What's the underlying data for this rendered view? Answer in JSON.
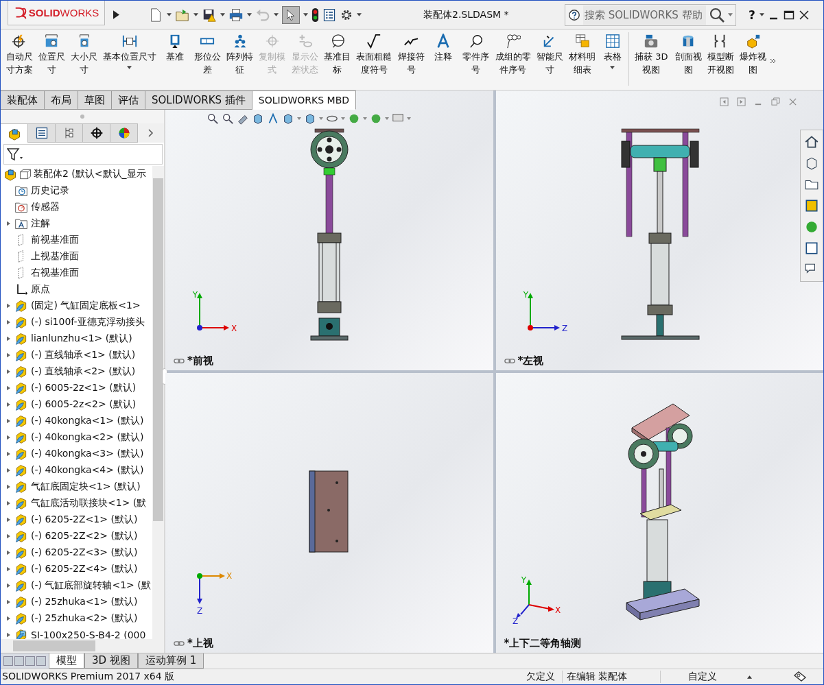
{
  "app": {
    "logo": "**SOLID**WORKS",
    "title": "装配体2.SLDASM *",
    "search": {
      "placeholder": "搜索 SOLIDWORKS 帮助"
    },
    "help": "?"
  },
  "ribbon": {
    "buttons": [
      {
        "label": "自动尺寸方案",
        "disabled": false,
        "dropdown": false
      },
      {
        "label": "位置尺寸",
        "disabled": false,
        "dropdown": false
      },
      {
        "label": "大小尺寸",
        "disabled": false,
        "dropdown": false
      },
      {
        "label": "基本位置尺寸",
        "disabled": false,
        "dropdown": true
      },
      {
        "label": "基准",
        "disabled": false,
        "dropdown": false
      },
      {
        "label": "形位公差",
        "disabled": false,
        "dropdown": false
      },
      {
        "label": "阵列特征",
        "disabled": false,
        "dropdown": false
      },
      {
        "label": "复制模式",
        "disabled": true,
        "dropdown": false
      },
      {
        "label": "显示公差状态",
        "disabled": true,
        "dropdown": false
      },
      {
        "label": "基准目标",
        "disabled": false,
        "dropdown": false
      },
      {
        "label": "表面粗糙度符号",
        "disabled": false,
        "dropdown": false
      },
      {
        "label": "焊接符号",
        "disabled": false,
        "dropdown": false
      },
      {
        "label": "注释",
        "disabled": false,
        "dropdown": false
      },
      {
        "label": "零件序号",
        "disabled": false,
        "dropdown": false
      },
      {
        "label": "成组的零件序号",
        "disabled": false,
        "dropdown": false
      },
      {
        "label": "智能尺寸",
        "disabled": false,
        "dropdown": false
      },
      {
        "label": "材料明细表",
        "disabled": false,
        "dropdown": false
      },
      {
        "label": "表格",
        "disabled": false,
        "dropdown": true
      },
      {
        "label": "捕获 3D 视图",
        "disabled": false,
        "dropdown": false
      },
      {
        "label": "剖面视图",
        "disabled": false,
        "dropdown": false
      },
      {
        "label": "模型断开视图",
        "disabled": false,
        "dropdown": false
      },
      {
        "label": "爆炸视图",
        "disabled": false,
        "dropdown": false
      }
    ]
  },
  "command_tabs": [
    {
      "label": "装配体",
      "selected": false
    },
    {
      "label": "布局",
      "selected": false
    },
    {
      "label": "草图",
      "selected": false
    },
    {
      "label": "评估",
      "selected": false
    },
    {
      "label": "SOLIDWORKS 插件",
      "selected": false
    },
    {
      "label": "SOLIDWORKS MBD",
      "selected": true
    }
  ],
  "panel_tabs": [
    {
      "selected": true
    },
    {
      "selected": false
    },
    {
      "selected": false
    },
    {
      "selected": false
    },
    {
      "selected": false
    }
  ],
  "feature_tree": {
    "items": [
      {
        "label": "装配体2  (默认<默认_显示",
        "kind": "assembly",
        "collapsible": false,
        "children": [
          {
            "label": "历史记录",
            "kind": "history",
            "collapsible": false
          },
          {
            "label": "传感器",
            "kind": "sensor",
            "collapsible": false
          },
          {
            "label": "注解",
            "kind": "annotation",
            "collapsible": true
          },
          {
            "label": "前视基准面",
            "kind": "plane",
            "collapsible": false
          },
          {
            "label": "上视基准面",
            "kind": "plane",
            "collapsible": false
          },
          {
            "label": "右视基准面",
            "kind": "plane",
            "collapsible": false
          },
          {
            "label": "原点",
            "kind": "origin",
            "collapsible": false
          },
          {
            "label": "(固定) 气缸固定底板<1>",
            "kind": "part",
            "collapsible": true
          },
          {
            "label": "(-) si100f-亚德克浮动接头",
            "kind": "part",
            "collapsible": true
          },
          {
            "label": "lianlunzhu<1> (默认)",
            "kind": "part",
            "collapsible": true
          },
          {
            "label": "(-) 直线轴承<1> (默认)",
            "kind": "part",
            "collapsible": true
          },
          {
            "label": "(-) 直线轴承<2> (默认)",
            "kind": "part",
            "collapsible": true
          },
          {
            "label": "(-) 6005-2z<1> (默认)",
            "kind": "part",
            "collapsible": true
          },
          {
            "label": "(-) 6005-2z<2> (默认)",
            "kind": "part",
            "collapsible": true
          },
          {
            "label": "(-) 40kongka<1> (默认)",
            "kind": "part",
            "collapsible": true
          },
          {
            "label": "(-) 40kongka<2> (默认)",
            "kind": "part",
            "collapsible": true
          },
          {
            "label": "(-) 40kongka<3> (默认)",
            "kind": "part",
            "collapsible": true
          },
          {
            "label": "(-) 40kongka<4> (默认)",
            "kind": "part",
            "collapsible": true
          },
          {
            "label": "气缸底固定块<1> (默认)",
            "kind": "part",
            "collapsible": true
          },
          {
            "label": "气缸底活动联接块<1> (默",
            "kind": "part",
            "collapsible": true
          },
          {
            "label": "(-) 6205-2Z<1> (默认)",
            "kind": "part",
            "collapsible": true
          },
          {
            "label": "(-) 6205-2Z<2> (默认)",
            "kind": "part",
            "collapsible": true
          },
          {
            "label": "(-) 6205-2Z<3> (默认)",
            "kind": "part",
            "collapsible": true
          },
          {
            "label": "(-) 6205-2Z<4> (默认)",
            "kind": "part",
            "collapsible": true
          },
          {
            "label": "(-) 气缸底部旋转轴<1> (默",
            "kind": "part",
            "collapsible": true
          },
          {
            "label": "(-) 25zhuka<1> (默认)",
            "kind": "part",
            "collapsible": true
          },
          {
            "label": "(-) 25zhuka<2> (默认)",
            "kind": "part",
            "collapsible": true
          },
          {
            "label": "SI-100x250-S-B4-2 (000",
            "kind": "subassembly",
            "collapsible": true
          }
        ]
      }
    ]
  },
  "viewports": [
    {
      "kind": "front",
      "label": "*前视",
      "linked": true,
      "axes": [
        "Y",
        "X"
      ]
    },
    {
      "kind": "left",
      "label": "*左视",
      "linked": true,
      "axes": [
        "Y",
        "Z"
      ]
    },
    {
      "kind": "top",
      "label": "*上视",
      "linked": true,
      "axes": [
        "X",
        "Z"
      ]
    },
    {
      "kind": "iso",
      "label": "*上下二等角轴测",
      "linked": false,
      "axes": [
        "Y",
        "X",
        "Z"
      ]
    }
  ],
  "bottom_tabs": [
    {
      "label": "模型",
      "selected": true
    },
    {
      "label": "3D 视图",
      "selected": false
    },
    {
      "label": "运动算例 1",
      "selected": false
    }
  ],
  "status_bar": {
    "product": "SOLIDWORKS Premium 2017 x64 版",
    "fields": [
      "欠定义",
      "在编辑 装配体",
      "自定义"
    ]
  }
}
